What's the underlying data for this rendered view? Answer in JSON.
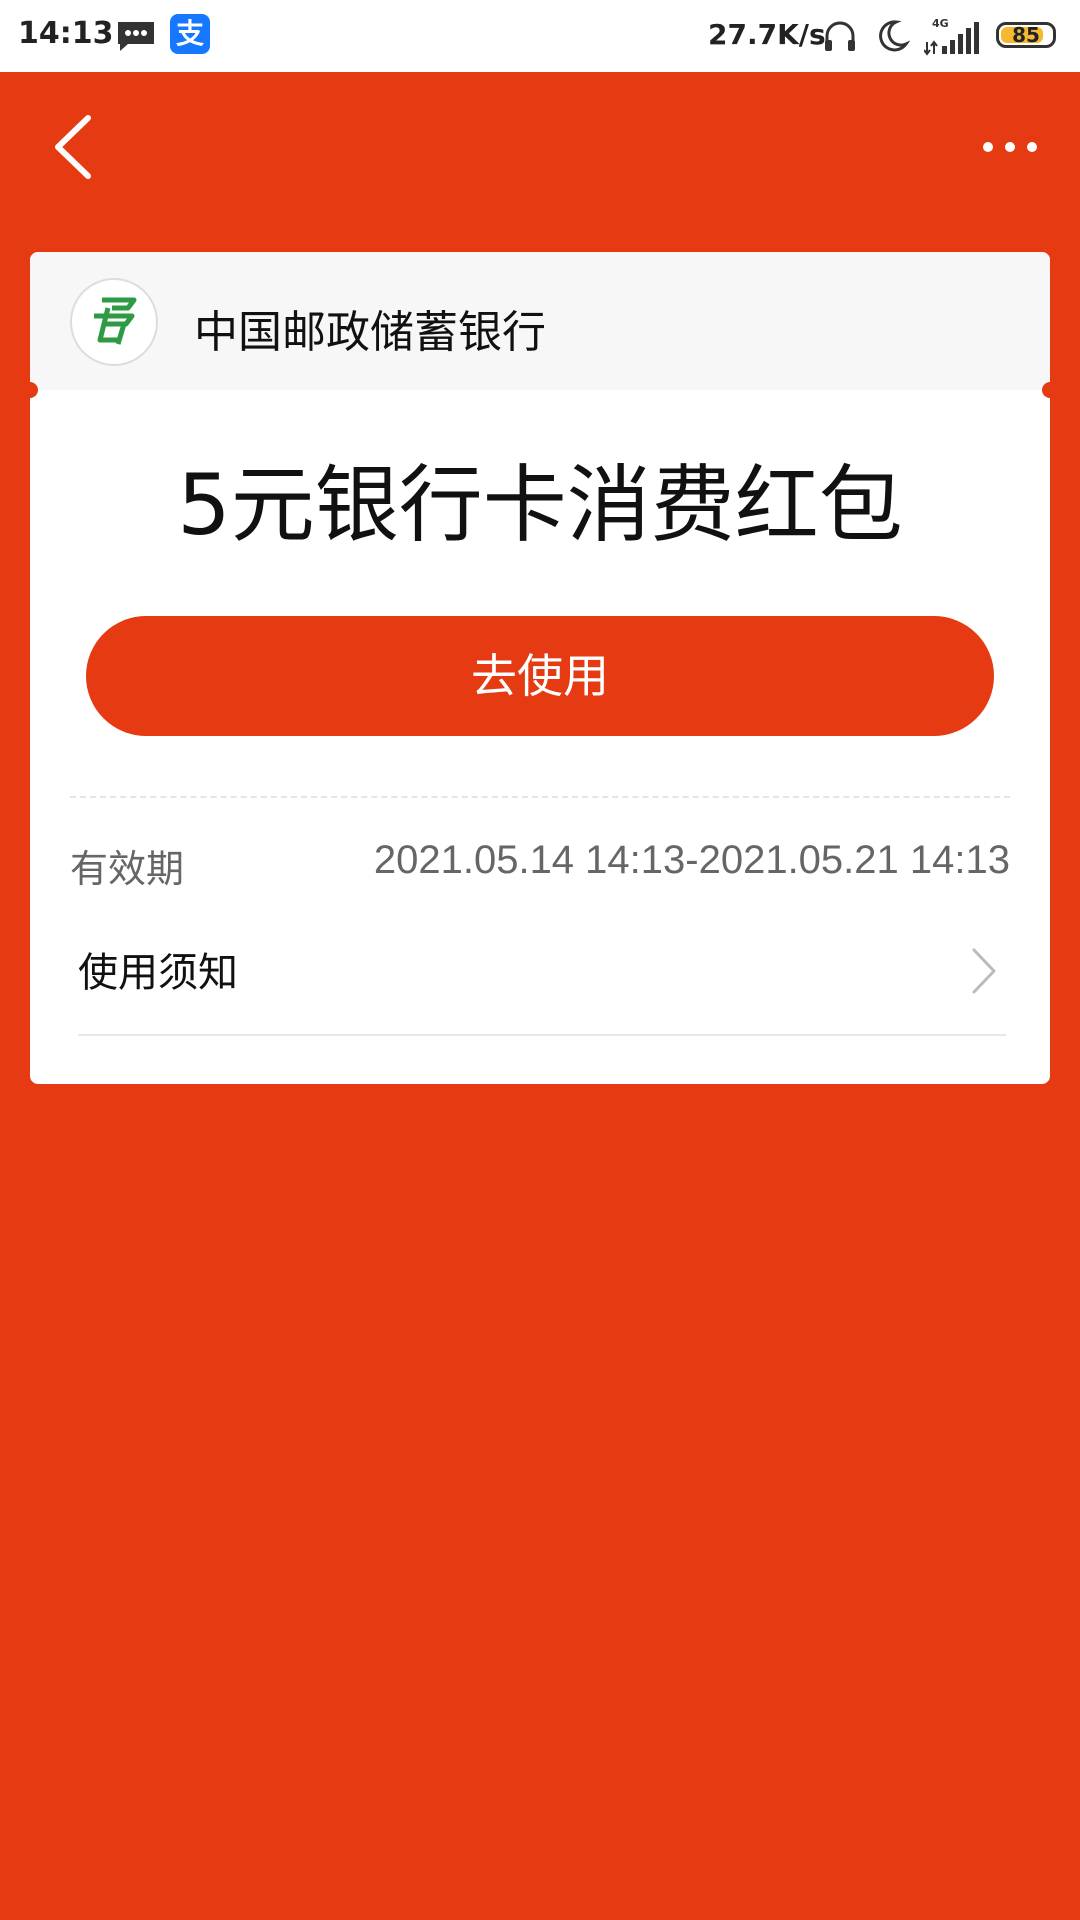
{
  "status_bar": {
    "time": "14:13",
    "alipay_glyph": "支",
    "network_speed": "27.7K/s",
    "network_type": "4G",
    "battery_level": 85,
    "battery_text": "85",
    "icons": [
      "message-icon",
      "alipay-icon",
      "headphone-icon",
      "moon-icon",
      "signal-icon",
      "battery-icon"
    ]
  },
  "nav": {
    "back_icon": "chevron-left-icon",
    "more_icon": "more-dots-icon"
  },
  "card": {
    "bank_name": "中国邮政储蓄银行",
    "bank_logo_icon": "postal-bank-logo",
    "title": "5元银行卡消费红包",
    "use_button_label": "去使用",
    "validity_label": "有效期",
    "validity_value": "2021.05.14 14:13-2021.05.21 14:13",
    "notice_label": "使用须知"
  },
  "colors": {
    "primary": "#e63a12",
    "card_header_bg": "#f7f7f7",
    "logo_green": "#2e9a44"
  }
}
